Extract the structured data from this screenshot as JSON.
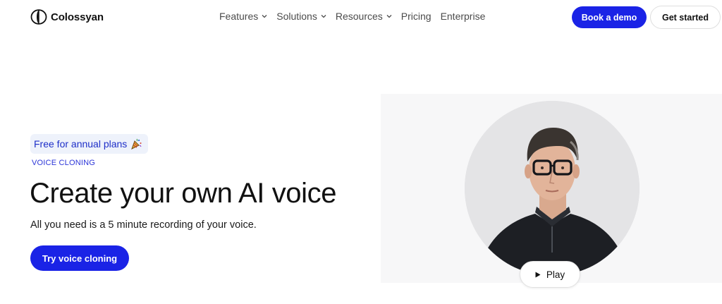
{
  "header": {
    "brand": "Colossyan",
    "nav": [
      {
        "label": "Features",
        "has_dropdown": true
      },
      {
        "label": "Solutions",
        "has_dropdown": true
      },
      {
        "label": "Resources",
        "has_dropdown": true
      },
      {
        "label": "Pricing",
        "has_dropdown": false
      },
      {
        "label": "Enterprise",
        "has_dropdown": false
      }
    ],
    "book_demo_label": "Book a demo",
    "get_started_label": "Get started"
  },
  "hero": {
    "badge_text": "Free for annual plans",
    "badge_icon": "party-popper-icon",
    "eyebrow": "VOICE CLONING",
    "headline": "Create your own AI voice",
    "subtext": "All you need is a 5 minute recording of your voice.",
    "cta_label": "Try voice cloning",
    "play_label": "Play",
    "play_icon": "play-icon"
  },
  "colors": {
    "accent": "#1a23e6",
    "badge_bg": "#eef2fb",
    "badge_text": "#1e2fc8"
  }
}
